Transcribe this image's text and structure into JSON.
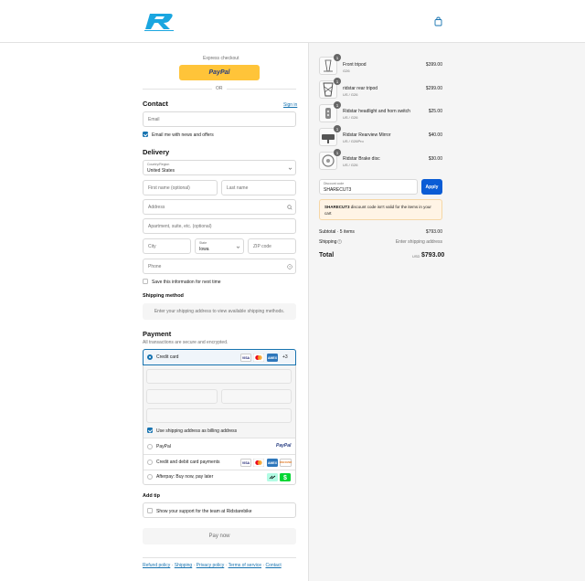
{
  "header": {
    "logo_text": "RIDSTAR",
    "cart_icon": "shopping-bag-icon"
  },
  "express": {
    "label": "Express checkout",
    "paypal_label": "PayPal",
    "or_label": "OR"
  },
  "contact": {
    "title": "Contact",
    "sign_in": "Sign in",
    "email_placeholder": "Email",
    "news_label": "Email me with news and offers"
  },
  "delivery": {
    "title": "Delivery",
    "country_label": "Country/Region",
    "country_value": "United States",
    "first_name": "First name (optional)",
    "last_name": "Last name",
    "address": "Address",
    "apartment": "Apartment, suite, etc. (optional)",
    "city": "City",
    "state_label": "State",
    "state_value": "Iowa",
    "zip": "ZIP code",
    "phone": "Phone",
    "save_label": "Save this information for next time"
  },
  "shipping_method": {
    "title": "Shipping method",
    "message": "Enter your shipping address to view available shipping methods."
  },
  "payment": {
    "title": "Payment",
    "subtitle": "All transactions are secure and encrypted.",
    "credit_card": "Credit card",
    "more_cards": "+3",
    "billing_label": "Use shipping address as billing address",
    "paypal": "PayPal",
    "paypal_logo": "PayPal",
    "credit_debit": "Credit and debit card payments",
    "afterpay": "Afterpay: Buy now, pay later",
    "card_brands": [
      "VISA",
      "MC",
      "AMEX",
      "DISCOVER"
    ]
  },
  "tip": {
    "title": "Add tip",
    "label": "Show your support for the team at Ridstarebike"
  },
  "pay_now": "Pay now",
  "footer_links": [
    "Refund policy",
    "Shipping",
    "Privacy policy",
    "Terms of service",
    "Contact"
  ],
  "summary": {
    "items": [
      {
        "name": "Front tripod",
        "variant": "G26",
        "price": "$399.00",
        "qty": "1"
      },
      {
        "name": "ridstar rear tripod",
        "variant": "US / G26",
        "price": "$299.00",
        "qty": "1"
      },
      {
        "name": "Ridstar headlight and horn switch",
        "variant": "US / G26",
        "price": "$25.00",
        "qty": "1"
      },
      {
        "name": "Ridstar Rearview Mirror",
        "variant": "US / G26Pro",
        "price": "$40.00",
        "qty": "1"
      },
      {
        "name": "Ridstar Brake disc",
        "variant": "US / G26",
        "price": "$30.00",
        "qty": "1"
      }
    ],
    "discount_label": "Discount code",
    "discount_value": "SHARECUT3",
    "apply": "Apply",
    "discount_error_code": "SHARECUT3",
    "discount_error_text": "discount code isn't valid for the items in your cart",
    "subtotal_label": "Subtotal · 5 items",
    "subtotal_value": "$793.00",
    "shipping_label": "Shipping",
    "shipping_value": "Enter shipping address",
    "total_label": "Total",
    "currency": "USD",
    "total_value": "$793.00"
  },
  "colors": {
    "accent": "#1773b0",
    "apply_button": "#0a5cd5",
    "paypal_yellow": "#ffc439",
    "error_bg": "#fff4e5",
    "logo_blue": "#1aa6e0"
  }
}
